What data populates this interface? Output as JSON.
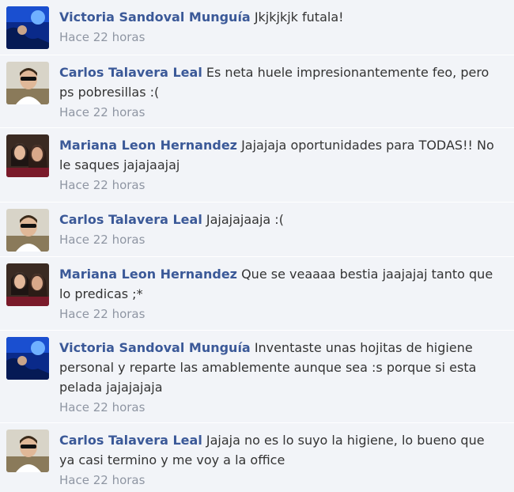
{
  "comments": [
    {
      "author": "Victoria Sandoval Munguía",
      "text": "Jkjkjkjk futala!",
      "time": "Hace 22 horas",
      "avatar": "avatar-blue-photo"
    },
    {
      "author": "Carlos Talavera Leal",
      "text": "Es neta huele impresionantemente feo, pero ps pobresillas :(",
      "time": "Hace 22 horas",
      "avatar": "avatar-man-sunglasses"
    },
    {
      "author": "Mariana Leon Hernandez",
      "text": "Jajajaja oportunidades para TODAS!! No le saques jajajaajaj",
      "time": "Hace 22 horas",
      "avatar": "avatar-two-women"
    },
    {
      "author": "Carlos Talavera Leal",
      "text": "Jajajajaaja :(",
      "time": "Hace 22 horas",
      "avatar": "avatar-man-sunglasses"
    },
    {
      "author": "Mariana Leon Hernandez",
      "text": "Que se veaaaa bestia jaajajaj tanto que lo predicas ;*",
      "time": "Hace 22 horas",
      "avatar": "avatar-two-women"
    },
    {
      "author": "Victoria Sandoval Munguía",
      "text": "Inventaste unas hojitas de higiene personal y reparte las amablemente aunque sea :s porque si esta pelada jajajajaja",
      "time": "Hace 22 horas",
      "avatar": "avatar-blue-photo"
    },
    {
      "author": "Carlos Talavera Leal",
      "text": "Jajaja no es lo suyo la higiene, lo bueno que ya casi termino y me voy a la office",
      "time": "Hace 22 horas",
      "avatar": "avatar-man-sunglasses"
    }
  ],
  "colors": {
    "author": "#3b5998",
    "time": "#8f96a3",
    "background": "#f2f4f8",
    "text": "#333333"
  }
}
